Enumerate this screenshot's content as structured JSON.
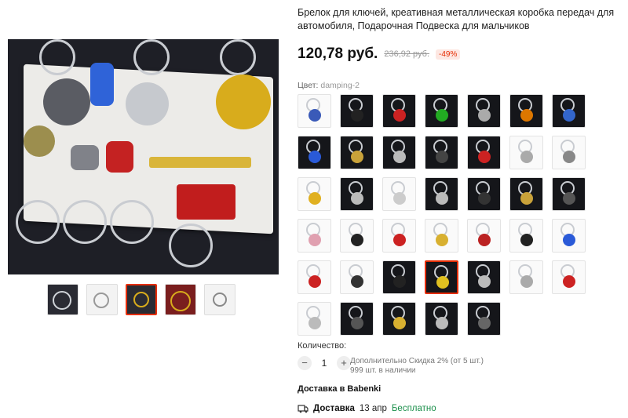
{
  "product": {
    "title": "Брелок для ключей, креативная металлическая коробка передач для автомобиля, Подарочная Подвеска для мальчиков",
    "price": "120,78 руб.",
    "old_price": "236,92 руб.",
    "discount": "-49%"
  },
  "color": {
    "label": "Цвет:",
    "selected": "damping-2"
  },
  "gallery": {
    "thumbnails": [
      {
        "icon": "wheel-keychain",
        "active": false
      },
      {
        "icon": "keychain-set",
        "active": false
      },
      {
        "icon": "keychain-collection",
        "active": true
      },
      {
        "icon": "wheel-gold",
        "active": false
      },
      {
        "icon": "ring-keychain",
        "active": false
      }
    ]
  },
  "swatches": [
    {
      "icon": "wheel-blue-gold",
      "bg": "light",
      "accent": "#3a5ab8"
    },
    {
      "icon": "caliper-black",
      "bg": "dark",
      "accent": "#222"
    },
    {
      "icon": "disc-red",
      "bg": "dark",
      "accent": "#c22"
    },
    {
      "icon": "disc-green",
      "bg": "dark",
      "accent": "#2a2"
    },
    {
      "icon": "disc-silver",
      "bg": "dark",
      "accent": "#aaa"
    },
    {
      "icon": "disc-orange",
      "bg": "dark",
      "accent": "#d70"
    },
    {
      "icon": "disc-blue",
      "bg": "dark",
      "accent": "#36c"
    },
    {
      "icon": "turbo-blue",
      "bg": "dark",
      "accent": "#2a5ad8"
    },
    {
      "icon": "turbo-gold",
      "bg": "dark",
      "accent": "#c9a23a"
    },
    {
      "icon": "gearbox-silver",
      "bg": "dark",
      "accent": "#bbb"
    },
    {
      "icon": "gearbox-black",
      "bg": "dark",
      "accent": "#444"
    },
    {
      "icon": "gearbox-red",
      "bg": "dark",
      "accent": "#c22"
    },
    {
      "icon": "wheel-silver",
      "bg": "light",
      "accent": "#aaa"
    },
    {
      "icon": "wheel-chrome",
      "bg": "light",
      "accent": "#888"
    },
    {
      "icon": "wheel-gold",
      "bg": "light",
      "accent": "#e0b020"
    },
    {
      "icon": "piston-silver",
      "bg": "dark",
      "accent": "#bbb"
    },
    {
      "icon": "turbo-white",
      "bg": "light",
      "accent": "#ccc"
    },
    {
      "icon": "piston-rod",
      "bg": "dark",
      "accent": "#bbb"
    },
    {
      "icon": "seat-black",
      "bg": "dark",
      "accent": "#333"
    },
    {
      "icon": "piston-gold",
      "bg": "dark",
      "accent": "#c9a23a"
    },
    {
      "icon": "turbo-black",
      "bg": "dark",
      "accent": "#555"
    },
    {
      "icon": "heart-pink",
      "bg": "light",
      "accent": "#e0a0b0"
    },
    {
      "icon": "heart-black",
      "bg": "light",
      "accent": "#222"
    },
    {
      "icon": "caliper-red",
      "bg": "light",
      "accent": "#c22"
    },
    {
      "icon": "shock-gold",
      "bg": "light",
      "accent": "#d8b030"
    },
    {
      "icon": "caliper-red-2",
      "bg": "light",
      "accent": "#b22"
    },
    {
      "icon": "seat-black-2",
      "bg": "light",
      "accent": "#222"
    },
    {
      "icon": "caliper-blue",
      "bg": "light",
      "accent": "#2a5ad8"
    },
    {
      "icon": "caliper-red-3",
      "bg": "light",
      "accent": "#c22"
    },
    {
      "icon": "seat-racing",
      "bg": "light",
      "accent": "#333"
    },
    {
      "icon": "shock-black",
      "bg": "dark",
      "accent": "#222"
    },
    {
      "icon": "shock-yellow",
      "bg": "dark",
      "accent": "#e0c020",
      "selected": true
    },
    {
      "icon": "piston-single",
      "bg": "dark",
      "accent": "#bbb"
    },
    {
      "icon": "shock-silver",
      "bg": "light",
      "accent": "#aaa"
    },
    {
      "icon": "shock-red",
      "bg": "light",
      "accent": "#c22"
    },
    {
      "icon": "shock-small",
      "bg": "light",
      "accent": "#bbb"
    },
    {
      "icon": "wheel-dark",
      "bg": "dark",
      "accent": "#555"
    },
    {
      "icon": "wheel-gold-2",
      "bg": "dark",
      "accent": "#d8b030"
    },
    {
      "icon": "wheel-silver-2",
      "bg": "dark",
      "accent": "#bbb"
    },
    {
      "icon": "disc-black",
      "bg": "dark",
      "accent": "#666"
    }
  ],
  "quantity": {
    "label": "Количество:",
    "minus": "−",
    "plus": "+",
    "value": "1",
    "discount_note": "Дополнительно Скидка 2% (от 5 шт.)",
    "stock": "999 шт. в наличии"
  },
  "delivery": {
    "heading": "Доставка в Babenki",
    "label": "Доставка",
    "date": "13 апр",
    "cost": "Бесплатно"
  }
}
